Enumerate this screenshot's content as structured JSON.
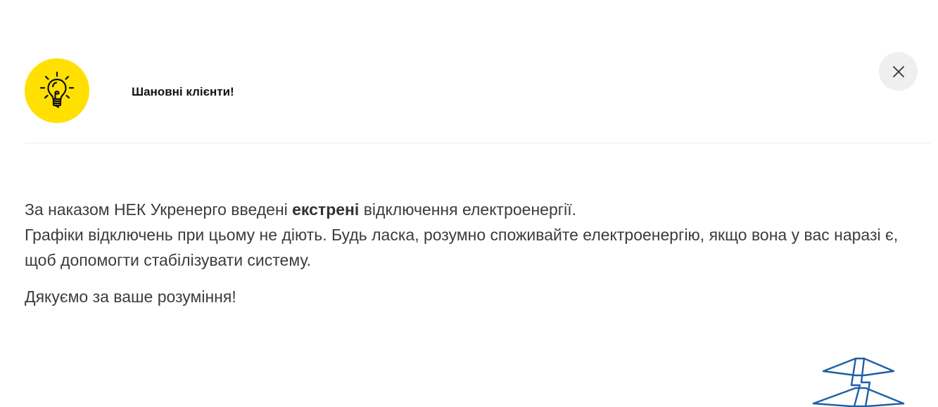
{
  "modal": {
    "title": "Шановні клієнти!",
    "icon": "lightbulb-icon",
    "close_icon": "close-icon",
    "accent_color": "#ffe000",
    "logo_color": "#1f5ea8"
  },
  "message": {
    "line1_prefix": "За наказом НЕК Укренерго введені ",
    "line1_bold": "екстрені",
    "line1_suffix": " відключення електроенергії.",
    "line2": "Графіки відключень при цьому не діють.  Будь ласка, розумно споживайте електроенергію, якщо вона у вас наразі є, щоб допомогти стабілізувати систему.",
    "thanks": "Дякуємо за ваше розуміння!"
  }
}
